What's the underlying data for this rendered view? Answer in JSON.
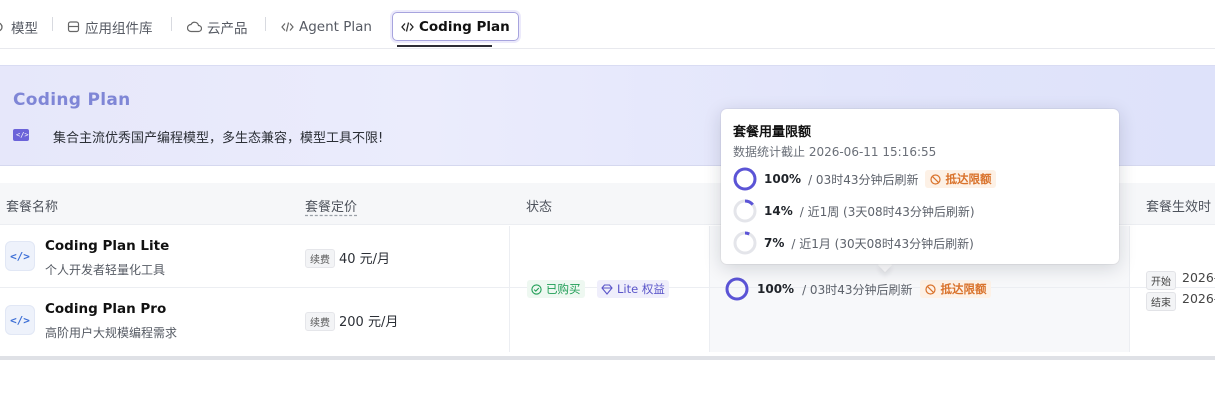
{
  "nav": {
    "items": [
      {
        "label": "模型"
      },
      {
        "label": "应用组件库"
      },
      {
        "label": "云产品"
      },
      {
        "label": "Agent Plan"
      },
      {
        "label": "Coding Plan"
      }
    ],
    "active": "Coding Plan"
  },
  "banner": {
    "title": "Coding Plan",
    "description": "集合主流优秀国产编程模型，多生态兼容，模型工具不限!"
  },
  "table": {
    "headers": {
      "name": "套餐名称",
      "price": "套餐定价",
      "status": "状态",
      "effective": "套餐生效时"
    },
    "rows": [
      {
        "name": "Coding Plan Lite",
        "subtitle": "个人开发者轻量化工具",
        "renew_tag": "续费",
        "price": "40 元/月"
      },
      {
        "name": "Coding Plan Pro",
        "subtitle": "高阶用户大规模编程需求",
        "renew_tag": "续费",
        "price": "200 元/月"
      }
    ],
    "status": {
      "owned": "已购买",
      "tier": "Lite 权益"
    },
    "usage": {
      "percent": "100%",
      "detail": "/ 03时43分钟后刷新",
      "limit": "抵达限额"
    },
    "dates": {
      "start_tag": "开始",
      "start_value": "2026-",
      "end_tag": "结束",
      "end_value": "2026-"
    }
  },
  "popover": {
    "title": "套餐用量限额",
    "subtitle": "数据统计截止 2026-06-11 15:16:55",
    "lines": [
      {
        "percent": "100%",
        "detail": "/ 03时43分钟后刷新",
        "limit": "抵达限额",
        "fraction": 1.0
      },
      {
        "percent": "14%",
        "detail": "/ 近1周 (3天08时43分钟后刷新)",
        "fraction": 0.14
      },
      {
        "percent": "7%",
        "detail": "/ 近1月 (30天08时43分钟后刷新)",
        "fraction": 0.07
      }
    ]
  },
  "colors": {
    "accent": "#5b54d6",
    "limit": "#d9722b",
    "owned": "#1f9d55"
  }
}
